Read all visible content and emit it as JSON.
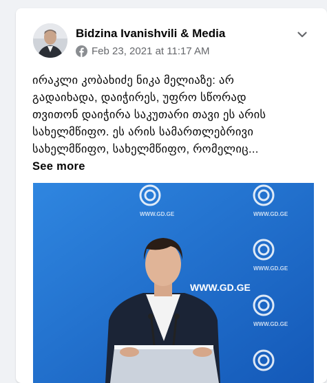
{
  "post": {
    "author": "Bidzina Ivanishvili & Media",
    "timestamp": "Feb 23, 2021 at 11:17 AM",
    "text_lines": [
      "ირაკლი კობახიძე ნიკა მელიაზე: არ",
      "გადაიხადა, დაიჭირეს, უფრო სწორად",
      "თვითონ დაიჭირა საკუთარი თავი ეს არის",
      "სახელმწიფო. ეს არის სამართლებრივი",
      "სახელმწიფო, სახელმწიფო, რომელიც..."
    ],
    "see_more": "See more",
    "image_watermark": "WWW.GD.GE"
  },
  "icons": {
    "avatar": "profile-photo",
    "privacy": "facebook-icon",
    "menu": "chevron-down-icon"
  },
  "colors": {
    "card_bg": "#ffffff",
    "page_bg": "#f0f2f5",
    "name_text": "#050505",
    "meta_text": "#65676b",
    "photo_bg": "#1e6fd0"
  }
}
